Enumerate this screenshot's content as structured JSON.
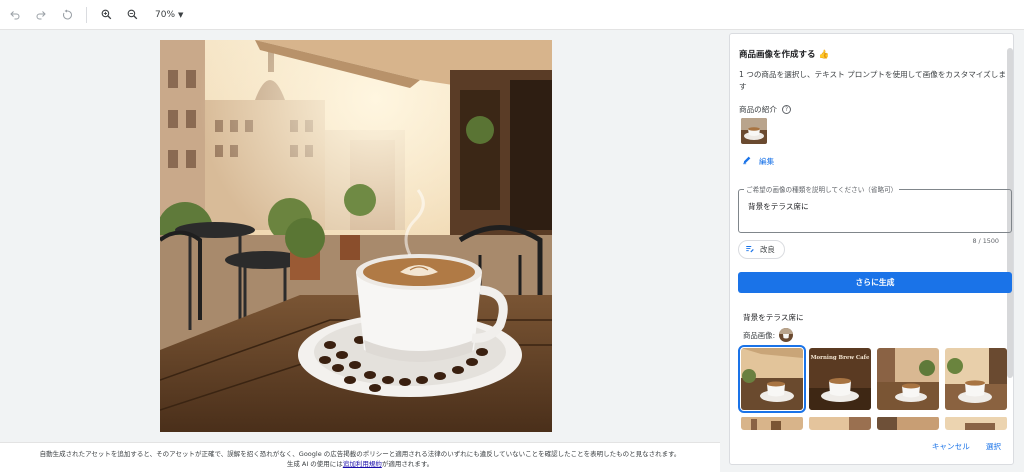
{
  "toolbar": {
    "zoom_value": "70%"
  },
  "icons": {
    "undo": "undo-icon",
    "redo": "redo-icon",
    "reset": "reset-icon",
    "zoom_in": "zoom-in-icon",
    "zoom_out": "zoom-out-icon",
    "help": "help-icon",
    "edit": "pencil-icon",
    "refine": "refine-icon"
  },
  "panel": {
    "title": "商品画像を作成する 👍",
    "description": "1 つの商品を選択し、テキスト プロンプトを使用して画像をカスタマイズします",
    "product_label": "商品の紹介",
    "edit_label": "編集",
    "prompt_label": "ご希望の画像の種類を説明してください（省略可）",
    "prompt_value": "背景をテラス席に",
    "prompt_counter": "8 / 1500",
    "refine_label": "改良",
    "generate_label": "さらに生成",
    "results_title": "背景をテラス席に",
    "results_sub": "商品画像:",
    "tile_text": "Morning Brew Cafe",
    "cancel_label": "キャンセル",
    "select_label": "選択"
  },
  "footer": {
    "line1": "自動生成されたアセットを追加すると、そのアセットが正確で、誤解を招く恐れがなく、Google の広告掲載のポリシーと適用される法律のいずれにも違反していないことを確認したことを表明したものと見なされます。",
    "line2_prefix": "生成 AI の使用には",
    "line2_link": "追加利用規約",
    "line2_suffix": "が適用されます。"
  },
  "colors": {
    "accent": "#1a73e8",
    "canvas_bg": "#f1f3f4"
  }
}
